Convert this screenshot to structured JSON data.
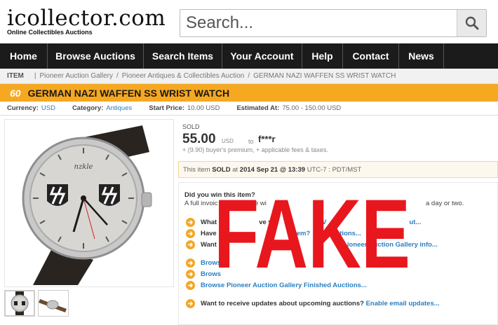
{
  "header": {
    "logo_text": "icollector.com",
    "logo_tagline": "Online Collectibles Auctions",
    "search_placeholder": "Search..."
  },
  "nav": {
    "items": [
      {
        "label": "Home"
      },
      {
        "label": "Browse Auctions"
      },
      {
        "label": "Search Items"
      },
      {
        "label": "Your Account"
      },
      {
        "label": "Help"
      },
      {
        "label": "Contact"
      },
      {
        "label": "News"
      }
    ]
  },
  "breadcrumb": {
    "tag": "ITEM",
    "items": [
      "Pioneer Auction Gallery",
      "Pioneer Antiques & Collectibles Auction",
      "GERMAN NAZI WAFFEN SS WRIST WATCH"
    ]
  },
  "lot": {
    "number": "60",
    "title": "GERMAN NAZI WAFFEN SS WRIST WATCH"
  },
  "info": {
    "currency_label": "Currency:",
    "currency_value": "USD",
    "category_label": "Category:",
    "category_value": "Antiques",
    "start_label": "Start Price:",
    "start_value": "10.00 USD",
    "estimate_label": "Estimated At:",
    "estimate_value": "75.00 - 150.00 USD"
  },
  "watch_dial_text": "nzkle",
  "sale": {
    "sold_label": "SOLD",
    "price": "55.00",
    "currency": "USD",
    "to_label": "to",
    "winner": "f***r",
    "premium": "+ (9.90) buyer's premium, + applicable fees & taxes.",
    "sold_prefix": "This item",
    "sold_word": "SOLD",
    "sold_mid": "at",
    "sold_date": "2014 Sep 21 @ 13:39",
    "sold_tz": "UTC-7 : PDT/MST"
  },
  "win": {
    "question": "Did you win this item?",
    "para_visible": "A full invoic",
    "para_mid": "e wi",
    "para_tail": "a day or two.",
    "bullets": [
      {
        "text": "What",
        "tail": "ve yo",
        "link_pre": "t? V",
        "link": "ut..."
      },
      {
        "text": "Have",
        "tail": "",
        "link_pre": "em?",
        "link": "tions..."
      },
      {
        "text": "Want",
        "tail": "",
        "link_pre": "",
        "link": "ioneer Auction Gallery info..."
      },
      {
        "text": "Brows",
        "tail": "",
        "link_pre": "",
        "link": "e Pioneer Auction Gallery upcoming auctions..."
      },
      {
        "text": "Brows",
        "tail": "",
        "link_pre": "",
        "link": "e Pioneer Auction Gallery auctions..."
      },
      {
        "text": "Browse Pioneer Auction Gallery",
        "tail": "",
        "link_pre": "",
        "link": "Finished Auctions..."
      },
      {
        "text": "Want to receive updates about upcoming auctions?",
        "tail": "",
        "link_pre": "",
        "link": "Enable email updates..."
      }
    ]
  },
  "stamp": {
    "text": "FAKE",
    "color": "#e8171d"
  },
  "colors": {
    "nav_bg": "#1b1b1b",
    "title_bar": "#f6a821",
    "link": "#2a7fc1",
    "bullet": "#f5a623"
  }
}
